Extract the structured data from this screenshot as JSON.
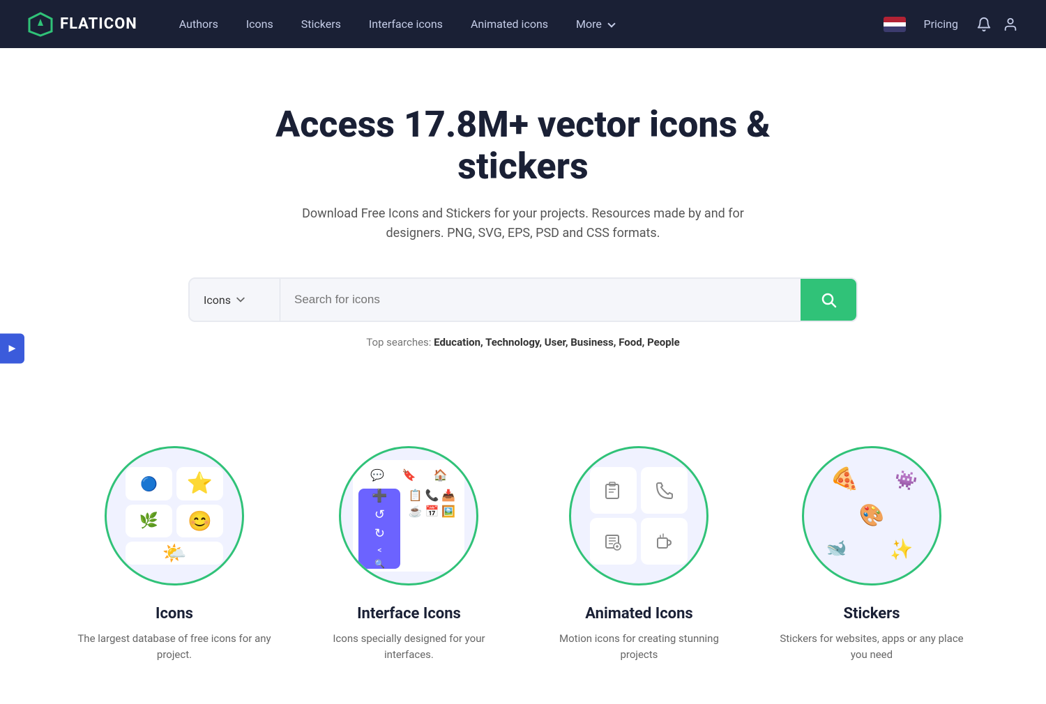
{
  "brand": {
    "name": "FLATICON",
    "logo_symbol": "▽"
  },
  "nav": {
    "links": [
      {
        "id": "authors",
        "label": "Authors"
      },
      {
        "id": "icons",
        "label": "Icons"
      },
      {
        "id": "stickers",
        "label": "Stickers"
      },
      {
        "id": "interface-icons",
        "label": "Interface icons"
      },
      {
        "id": "animated-icons",
        "label": "Animated icons"
      },
      {
        "id": "more",
        "label": "More"
      }
    ],
    "pricing_label": "Pricing",
    "notification_icon": "bell",
    "user_icon": "user"
  },
  "hero": {
    "headline": "Access 17.8M+ vector icons & stickers",
    "subheadline": "Download Free Icons and Stickers for your projects. Resources made by and for designers. PNG, SVG, EPS, PSD and CSS formats.",
    "search": {
      "type_label": "Icons",
      "placeholder": "Search for icons",
      "button_icon": "search"
    },
    "top_searches_label": "Top searches:",
    "top_searches": "Education, Technology, User, Business, Food, People"
  },
  "side_tab": {
    "label": "▶"
  },
  "categories": [
    {
      "id": "icons",
      "title": "Icons",
      "description": "The largest database of free icons for any project."
    },
    {
      "id": "interface-icons",
      "title": "Interface Icons",
      "description": "Icons specially designed for your interfaces."
    },
    {
      "id": "animated-icons",
      "title": "Animated Icons",
      "description": "Motion icons for creating stunning projects"
    },
    {
      "id": "stickers",
      "title": "Stickers",
      "description": "Stickers for websites, apps or any place you need"
    }
  ]
}
